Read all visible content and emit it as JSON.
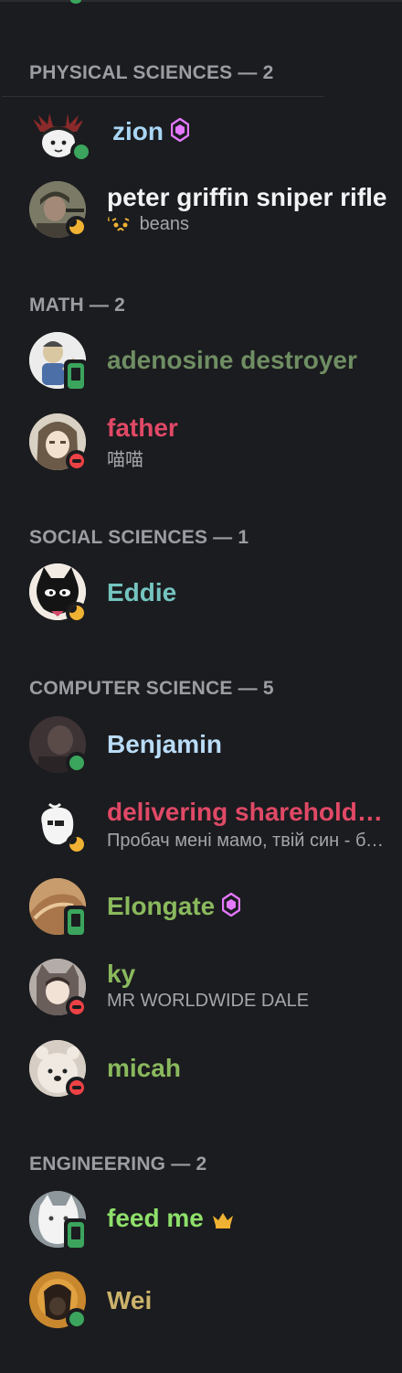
{
  "sections": [
    {
      "title": "PHYSICAL SCIENCES — 2"
    },
    {
      "title": "MATH — 2"
    },
    {
      "title": "SOCIAL SCIENCES — 1"
    },
    {
      "title": "COMPUTER SCIENCE — 5"
    },
    {
      "title": "ENGINEERING — 2"
    }
  ],
  "members": [
    {
      "name": "zion",
      "color": "#a9d6f5",
      "status": "online",
      "badge": "boost"
    },
    {
      "name": "peter griffin sniper rifle",
      "color": "#f2f3f5",
      "status": "idle",
      "activity": "beans",
      "activity_icon": "emoji-face-icon"
    },
    {
      "name": "adenosine destroyer",
      "color": "#6f8e63",
      "status": "mobile"
    },
    {
      "name": "father",
      "color": "#e04966",
      "status": "dnd",
      "activity": "喵喵"
    },
    {
      "name": "Eddie",
      "color": "#74c4c0",
      "status": "idle"
    },
    {
      "name": "Benjamin",
      "color": "#b9dcf7",
      "status": "online"
    },
    {
      "name": "delivering shareholder value",
      "color": "#e04966",
      "status": "idle",
      "activity": "Пробач мені мамо, твій син - бандит"
    },
    {
      "name": "Elongate",
      "color": "#8ab95d",
      "status": "mobile",
      "badge": "boost"
    },
    {
      "name": "ky",
      "color": "#8ab95d",
      "status": "dnd",
      "activity": "MR WORLDWIDE DALE"
    },
    {
      "name": "micah",
      "color": "#8ab95d",
      "status": "dnd"
    },
    {
      "name": "feed me",
      "color": "#8ee06a",
      "status": "mobile",
      "badge": "crown"
    },
    {
      "name": "Wei",
      "color": "#cbb36b",
      "status": "online"
    }
  ]
}
